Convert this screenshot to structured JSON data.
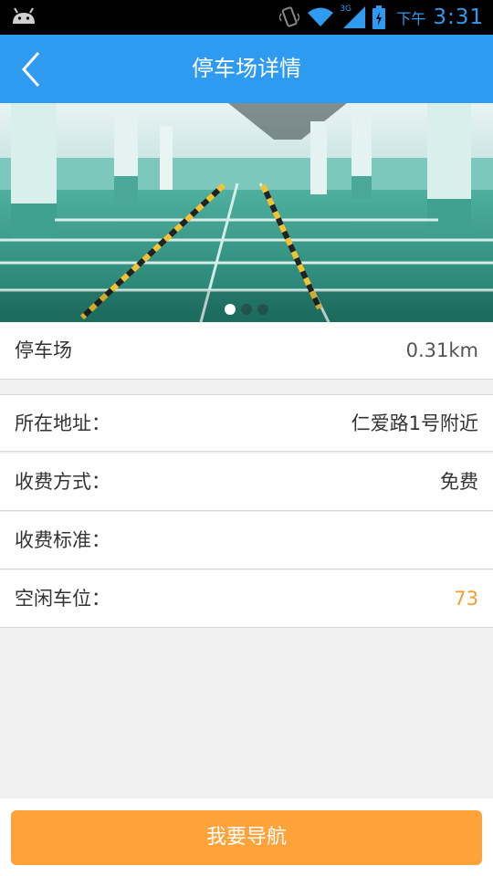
{
  "status_bar": {
    "network": "3G",
    "ampm": "下午",
    "time": "3:31",
    "icons": [
      "android-icon",
      "vibrate-icon",
      "wifi-icon",
      "signal-icon",
      "battery-icon"
    ]
  },
  "app_bar": {
    "title": "停车场详情",
    "back_icon": "back-arrow-icon"
  },
  "hero": {
    "image_subject": "underground parking garage",
    "total_pages": 3,
    "active_page": 1
  },
  "summary": {
    "name": "停车场",
    "distance": "0.31km"
  },
  "details": [
    {
      "label": "所在地址：",
      "value": "仁爱路1号附近"
    },
    {
      "label": "收费方式：",
      "value": "免费"
    },
    {
      "label": "收费标准：",
      "value": ""
    },
    {
      "label": "空闲车位：",
      "value": "73"
    }
  ],
  "navigate_button": {
    "label": "我要导航"
  },
  "colors": {
    "primary": "#2f9bf0",
    "accent": "#ffa23a",
    "highlight_value": "#f0a030"
  }
}
